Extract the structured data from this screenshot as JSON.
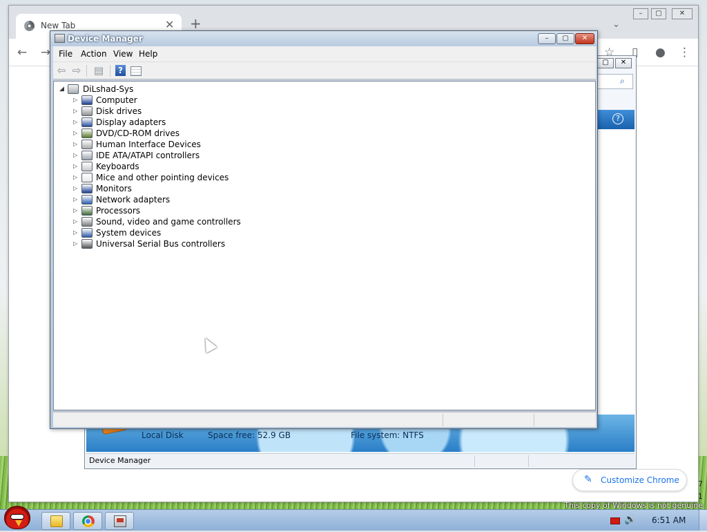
{
  "desktop": {
    "genuine_line1": "7",
    "genuine_line2": "1",
    "genuine_notice": "This copy of Windows is not genuine"
  },
  "chrome": {
    "tab_title": "New Tab",
    "tab_close": "✕",
    "new_tab": "+",
    "tab_search": "⌄",
    "caption_min": "–",
    "caption_max": "▢",
    "caption_close": "✕",
    "back": "←",
    "forward": "→",
    "bookmark": "☆",
    "side_panel": "▯",
    "profile": "●",
    "menu": "⋮",
    "customize_label": "Customize Chrome",
    "customize_icon": "✎"
  },
  "explorer": {
    "caption_max": "▢",
    "caption_close": "✕",
    "search_icon": "⌕",
    "help_icon": "?",
    "drive_name": "Local Disk",
    "space_free": "Space free: 52.9 GB",
    "file_system": "File system: NTFS",
    "status": "Device Manager"
  },
  "device_manager": {
    "title": "Device Manager",
    "caption_min": "–",
    "caption_max": "▢",
    "caption_close": "✕",
    "menu": [
      "File",
      "Action",
      "View",
      "Help"
    ],
    "toolbar": {
      "back": "⇦",
      "forward": "⇨",
      "show_hide": "▤",
      "help": "?"
    },
    "root": {
      "expander": "◢",
      "label": "DiLshad-Sys"
    },
    "expander": "▷",
    "categories": [
      {
        "label": "Computer",
        "color": "#1b3f94"
      },
      {
        "label": "Disk drives",
        "color": "#8f8f8f"
      },
      {
        "label": "Display adapters",
        "color": "#244f9f"
      },
      {
        "label": "DVD/CD-ROM drives",
        "color": "#5a7a2c"
      },
      {
        "label": "Human Interface Devices",
        "color": "#a9a9a9"
      },
      {
        "label": "IDE ATA/ATAPI controllers",
        "color": "#9ba3aa"
      },
      {
        "label": "Keyboards",
        "color": "#c9c9c9"
      },
      {
        "label": "Mice and other pointing devices",
        "color": "#e9e9e9"
      },
      {
        "label": "Monitors",
        "color": "#1b3f94"
      },
      {
        "label": "Network adapters",
        "color": "#2b5fb0"
      },
      {
        "label": "Processors",
        "color": "#3f6b3a"
      },
      {
        "label": "Sound, video and game controllers",
        "color": "#7d7d7d"
      },
      {
        "label": "System devices",
        "color": "#2f5aa6"
      },
      {
        "label": "Universal Serial Bus controllers",
        "color": "#555555"
      }
    ]
  },
  "taskbar": {
    "clock": "6:51 AM",
    "speaker": "🔊"
  }
}
